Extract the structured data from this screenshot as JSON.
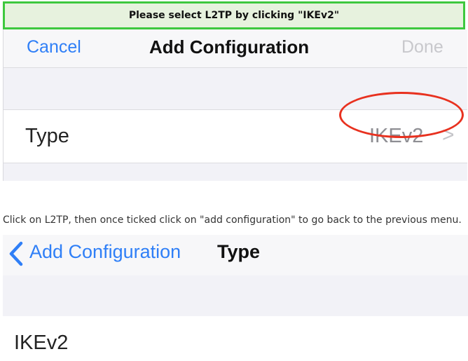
{
  "banner": {
    "text": "Please select L2TP by clicking \"IKEv2\""
  },
  "screen1": {
    "nav": {
      "cancel": "Cancel",
      "title": "Add Configuration",
      "done": "Done"
    },
    "type_row": {
      "label": "Type",
      "value": "IKEv2",
      "chevron": ">"
    }
  },
  "instruction": "Click on L2TP, then once ticked click on \"add configuration\" to go back to the previous menu.",
  "screen2": {
    "nav": {
      "back_label": "Add Configuration",
      "title": "Type"
    },
    "options": [
      "IKEv2"
    ]
  },
  "icons": {
    "back": "chevron-left-icon",
    "disclosure": "chevron-right-icon"
  },
  "colors": {
    "accent": "#2f7ff7",
    "highlight_circle": "#e8311f",
    "banner_border": "#3ec83e"
  }
}
